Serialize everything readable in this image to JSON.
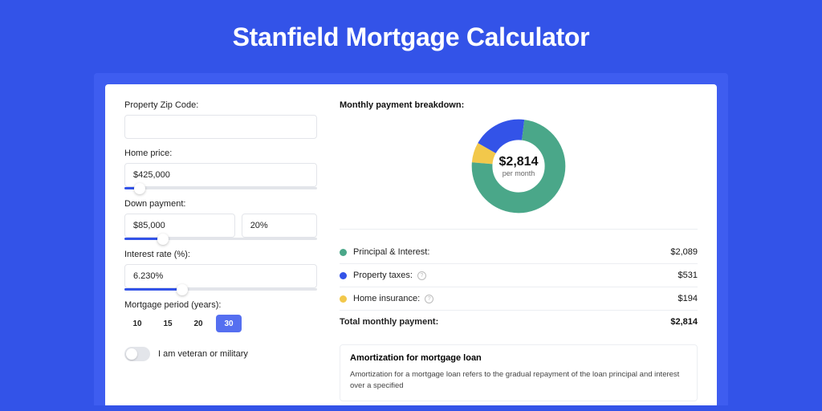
{
  "colors": {
    "green": "#4aa789",
    "blue": "#3353e8",
    "yellow": "#f2c84b"
  },
  "page_title": "Stanfield Mortgage Calculator",
  "form": {
    "zip": {
      "label": "Property Zip Code:",
      "value": ""
    },
    "home_price": {
      "label": "Home price:",
      "value": "$425,000",
      "slider_pct": 8
    },
    "down_payment": {
      "label": "Down payment:",
      "value": "$85,000",
      "pct": "20%",
      "slider_pct": 20
    },
    "interest_rate": {
      "label": "Interest rate (%):",
      "value": "6.230%",
      "slider_pct": 30
    },
    "mortgage_period": {
      "label": "Mortgage period (years):",
      "options": [
        "10",
        "15",
        "20",
        "30"
      ],
      "selected": "30"
    },
    "veteran": {
      "label": "I am veteran or military",
      "value": false
    }
  },
  "breakdown": {
    "title": "Monthly payment breakdown:",
    "total_center": "$2,814",
    "per_month": "per month",
    "items": [
      {
        "label": "Principal & Interest:",
        "value": "$2,089",
        "colorKey": "green",
        "hint": false,
        "pct": 74.2
      },
      {
        "label": "Property taxes:",
        "value": "$531",
        "colorKey": "blue",
        "hint": true,
        "pct": 18.9
      },
      {
        "label": "Home insurance:",
        "value": "$194",
        "colorKey": "yellow",
        "hint": true,
        "pct": 6.9
      }
    ],
    "total_label": "Total monthly payment:",
    "total_value": "$2,814"
  },
  "amortization": {
    "title": "Amortization for mortgage loan",
    "text": "Amortization for a mortgage loan refers to the gradual repayment of the loan principal and interest over a specified"
  },
  "chart_data": {
    "type": "pie",
    "title": "Monthly payment breakdown",
    "categories": [
      "Principal & Interest",
      "Property taxes",
      "Home insurance"
    ],
    "values": [
      2089,
      531,
      194
    ],
    "total": 2814,
    "unit": "$ per month"
  }
}
